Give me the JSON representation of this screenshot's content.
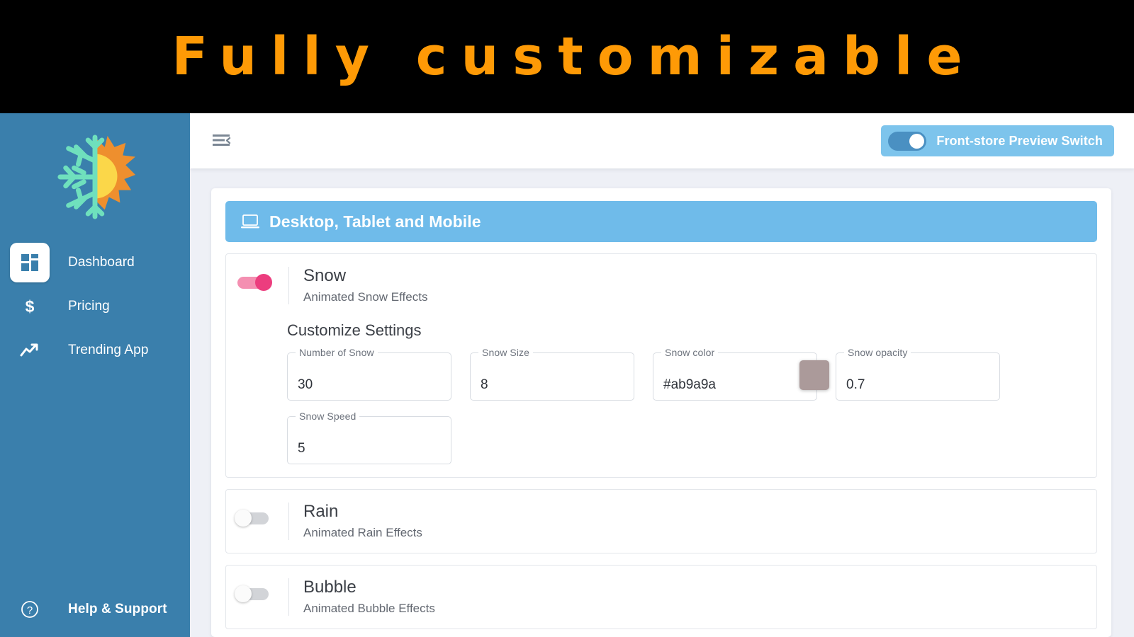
{
  "banner": {
    "title": "Fully customizable",
    "text_color": "#fe9a06",
    "background": "#000000"
  },
  "sidebar": {
    "background": "#3a7fac",
    "logo_name": "snowflake-sun-logo",
    "items": [
      {
        "label": "Dashboard",
        "icon": "dashboard-grid-icon",
        "active": true
      },
      {
        "label": "Pricing",
        "icon": "dollar-icon",
        "active": false
      },
      {
        "label": "Trending App",
        "icon": "trending-up-icon",
        "active": false
      }
    ],
    "bottom_item": {
      "label": "Help & Support",
      "icon": "question-circle-icon"
    }
  },
  "topbar": {
    "collapse_icon": "menu-collapse-icon",
    "preview_switch": {
      "label": "Front-store Preview Switch",
      "enabled": true,
      "background": "#7dc4ec",
      "track_color": "#4a90c2"
    }
  },
  "panel": {
    "header": {
      "icon": "desktop-icon",
      "title": "Desktop, Tablet and Mobile",
      "background": "#6fbbea"
    },
    "effects": [
      {
        "name": "Snow",
        "description": "Animated Snow Effects",
        "enabled": true,
        "toggle_color": "#ec3d7e",
        "customize_title": "Customize Settings",
        "fields": [
          {
            "label": "Number of Snow",
            "value": "30"
          },
          {
            "label": "Snow Size",
            "value": "8"
          },
          {
            "label": "Snow color",
            "value": "#ab9a9a",
            "swatch": "#ab9a9a"
          },
          {
            "label": "Snow opacity",
            "value": "0.7"
          },
          {
            "label": "Snow Speed",
            "value": "5"
          }
        ]
      },
      {
        "name": "Rain",
        "description": "Animated Rain Effects",
        "enabled": false,
        "fields": []
      },
      {
        "name": "Bubble",
        "description": "Animated Bubble Effects",
        "enabled": false,
        "fields": []
      }
    ]
  }
}
